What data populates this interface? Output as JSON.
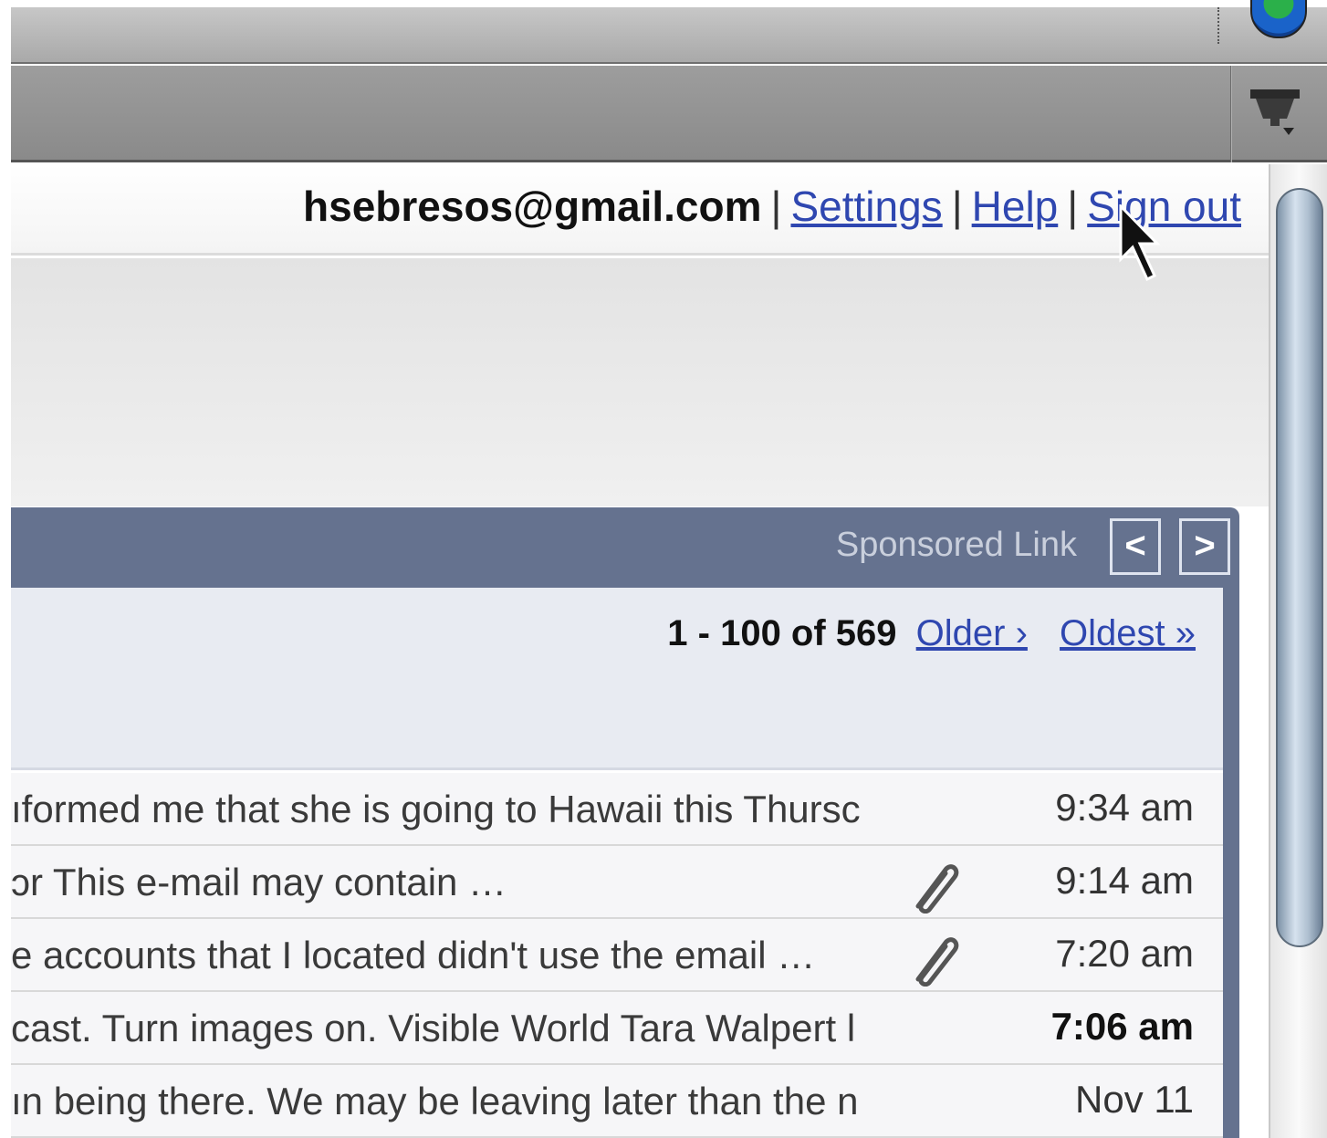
{
  "header": {
    "email": "hsebresos@gmail.com",
    "separator": "|",
    "links": [
      "Settings",
      "Help",
      "Sign out"
    ]
  },
  "panel": {
    "sponsored_label": "Sponsored Link",
    "prev_label": "<",
    "next_label": ">"
  },
  "pager": {
    "count": "1 - 100 of 569",
    "older": "Older ›",
    "oldest": "Oldest »"
  },
  "rows": [
    {
      "snippet": "ıformed me that she is going to Hawaii this Thursc",
      "attachment": false,
      "time": "9:34 am",
      "unread": false
    },
    {
      "snippet": "ɔr This e-mail may contain …",
      "attachment": true,
      "time": "9:14 am",
      "unread": false
    },
    {
      "snippet": "e accounts that I located didn't use the email …",
      "attachment": true,
      "time": "7:20 am",
      "unread": false
    },
    {
      "snippet": "cast. Turn images on. Visible World Tara Walpert l",
      "attachment": false,
      "time": "7:06 am",
      "unread": true
    },
    {
      "snippet": "ın being there. We may be leaving later than the n",
      "attachment": false,
      "time": "Nov 11",
      "unread": false
    }
  ],
  "icons": {
    "browser": "globe-icon",
    "menu": "menu-icon",
    "attachment": "paperclip-icon",
    "cursor": "mouse-cursor-icon"
  },
  "colors": {
    "link": "#2f47b0",
    "panel": "#65728f"
  }
}
